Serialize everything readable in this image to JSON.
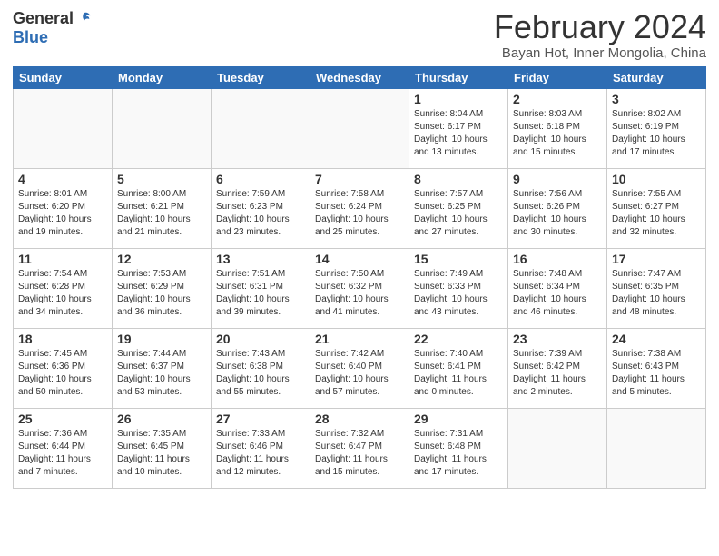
{
  "logo": {
    "general": "General",
    "blue": "Blue"
  },
  "title": "February 2024",
  "subtitle": "Bayan Hot, Inner Mongolia, China",
  "days_of_week": [
    "Sunday",
    "Monday",
    "Tuesday",
    "Wednesday",
    "Thursday",
    "Friday",
    "Saturday"
  ],
  "weeks": [
    [
      {
        "day": "",
        "info": ""
      },
      {
        "day": "",
        "info": ""
      },
      {
        "day": "",
        "info": ""
      },
      {
        "day": "",
        "info": ""
      },
      {
        "day": "1",
        "info": "Sunrise: 8:04 AM\nSunset: 6:17 PM\nDaylight: 10 hours\nand 13 minutes."
      },
      {
        "day": "2",
        "info": "Sunrise: 8:03 AM\nSunset: 6:18 PM\nDaylight: 10 hours\nand 15 minutes."
      },
      {
        "day": "3",
        "info": "Sunrise: 8:02 AM\nSunset: 6:19 PM\nDaylight: 10 hours\nand 17 minutes."
      }
    ],
    [
      {
        "day": "4",
        "info": "Sunrise: 8:01 AM\nSunset: 6:20 PM\nDaylight: 10 hours\nand 19 minutes."
      },
      {
        "day": "5",
        "info": "Sunrise: 8:00 AM\nSunset: 6:21 PM\nDaylight: 10 hours\nand 21 minutes."
      },
      {
        "day": "6",
        "info": "Sunrise: 7:59 AM\nSunset: 6:23 PM\nDaylight: 10 hours\nand 23 minutes."
      },
      {
        "day": "7",
        "info": "Sunrise: 7:58 AM\nSunset: 6:24 PM\nDaylight: 10 hours\nand 25 minutes."
      },
      {
        "day": "8",
        "info": "Sunrise: 7:57 AM\nSunset: 6:25 PM\nDaylight: 10 hours\nand 27 minutes."
      },
      {
        "day": "9",
        "info": "Sunrise: 7:56 AM\nSunset: 6:26 PM\nDaylight: 10 hours\nand 30 minutes."
      },
      {
        "day": "10",
        "info": "Sunrise: 7:55 AM\nSunset: 6:27 PM\nDaylight: 10 hours\nand 32 minutes."
      }
    ],
    [
      {
        "day": "11",
        "info": "Sunrise: 7:54 AM\nSunset: 6:28 PM\nDaylight: 10 hours\nand 34 minutes."
      },
      {
        "day": "12",
        "info": "Sunrise: 7:53 AM\nSunset: 6:29 PM\nDaylight: 10 hours\nand 36 minutes."
      },
      {
        "day": "13",
        "info": "Sunrise: 7:51 AM\nSunset: 6:31 PM\nDaylight: 10 hours\nand 39 minutes."
      },
      {
        "day": "14",
        "info": "Sunrise: 7:50 AM\nSunset: 6:32 PM\nDaylight: 10 hours\nand 41 minutes."
      },
      {
        "day": "15",
        "info": "Sunrise: 7:49 AM\nSunset: 6:33 PM\nDaylight: 10 hours\nand 43 minutes."
      },
      {
        "day": "16",
        "info": "Sunrise: 7:48 AM\nSunset: 6:34 PM\nDaylight: 10 hours\nand 46 minutes."
      },
      {
        "day": "17",
        "info": "Sunrise: 7:47 AM\nSunset: 6:35 PM\nDaylight: 10 hours\nand 48 minutes."
      }
    ],
    [
      {
        "day": "18",
        "info": "Sunrise: 7:45 AM\nSunset: 6:36 PM\nDaylight: 10 hours\nand 50 minutes."
      },
      {
        "day": "19",
        "info": "Sunrise: 7:44 AM\nSunset: 6:37 PM\nDaylight: 10 hours\nand 53 minutes."
      },
      {
        "day": "20",
        "info": "Sunrise: 7:43 AM\nSunset: 6:38 PM\nDaylight: 10 hours\nand 55 minutes."
      },
      {
        "day": "21",
        "info": "Sunrise: 7:42 AM\nSunset: 6:40 PM\nDaylight: 10 hours\nand 57 minutes."
      },
      {
        "day": "22",
        "info": "Sunrise: 7:40 AM\nSunset: 6:41 PM\nDaylight: 11 hours\nand 0 minutes."
      },
      {
        "day": "23",
        "info": "Sunrise: 7:39 AM\nSunset: 6:42 PM\nDaylight: 11 hours\nand 2 minutes."
      },
      {
        "day": "24",
        "info": "Sunrise: 7:38 AM\nSunset: 6:43 PM\nDaylight: 11 hours\nand 5 minutes."
      }
    ],
    [
      {
        "day": "25",
        "info": "Sunrise: 7:36 AM\nSunset: 6:44 PM\nDaylight: 11 hours\nand 7 minutes."
      },
      {
        "day": "26",
        "info": "Sunrise: 7:35 AM\nSunset: 6:45 PM\nDaylight: 11 hours\nand 10 minutes."
      },
      {
        "day": "27",
        "info": "Sunrise: 7:33 AM\nSunset: 6:46 PM\nDaylight: 11 hours\nand 12 minutes."
      },
      {
        "day": "28",
        "info": "Sunrise: 7:32 AM\nSunset: 6:47 PM\nDaylight: 11 hours\nand 15 minutes."
      },
      {
        "day": "29",
        "info": "Sunrise: 7:31 AM\nSunset: 6:48 PM\nDaylight: 11 hours\nand 17 minutes."
      },
      {
        "day": "",
        "info": ""
      },
      {
        "day": "",
        "info": ""
      }
    ]
  ]
}
